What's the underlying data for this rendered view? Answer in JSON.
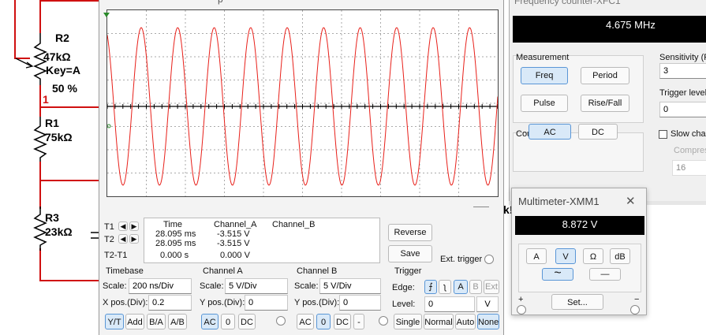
{
  "circuit": {
    "r2_name": "R2",
    "r2_value": "47kΩ",
    "r2_key": "Key=A",
    "r2_percent": "50 %",
    "node_number": "1",
    "r1_name": "R1",
    "r1_value": "75kΩ",
    "r3_name": "R3",
    "r3_value": "23kΩ",
    "clipped_label": "k!"
  },
  "oscilloscope": {
    "title_fragment": "p",
    "readout": {
      "headers": [
        "Time",
        "Channel_A",
        "Channel_B"
      ],
      "t1_label": "T1",
      "t2_label": "T2",
      "t2t1_label": "T2-T1",
      "t1": [
        "28.095 ms",
        "-3.515 V",
        ""
      ],
      "t2": [
        "28.095 ms",
        "-3.515 V",
        ""
      ],
      "t2t1": [
        "0.000 s",
        "0.000 V",
        ""
      ]
    },
    "reverse_label": "Reverse",
    "save_label": "Save",
    "ext_trigger_label": "Ext. trigger",
    "timebase": {
      "title": "Timebase",
      "scale_label": "Scale:",
      "scale_value": "200 ns/Div",
      "xpos_label": "X pos.(Div):",
      "xpos_value": "0.2",
      "buttons": [
        "Y/T",
        "Add",
        "B/A",
        "A/B"
      ]
    },
    "channel_a": {
      "title": "Channel A",
      "scale_label": "Scale:",
      "scale_value": "5  V/Div",
      "ypos_label": "Y pos.(Div):",
      "ypos_value": "0",
      "buttons": [
        "AC",
        "0",
        "DC"
      ]
    },
    "channel_b": {
      "title": "Channel B",
      "scale_label": "Scale:",
      "scale_value": "5  V/Div",
      "ypos_label": "Y pos.(Div):",
      "ypos_value": "0",
      "buttons": [
        "AC",
        "0",
        "DC",
        "-"
      ]
    },
    "trigger": {
      "title": "Trigger",
      "edge_label": "Edge:",
      "edge_buttons": [
        "⨍",
        "ʅ",
        "A",
        "B",
        "Ext"
      ],
      "level_label": "Level:",
      "level_value": "0",
      "level_unit": "V",
      "mode_buttons": [
        "Single",
        "Normal",
        "Auto",
        "None"
      ]
    },
    "trace_color": "#e8201a"
  },
  "frequency_counter": {
    "title": "Frequency counter-XFC1",
    "display_value": "4.675 MHz",
    "measurement_title": "Measurement",
    "measurement_buttons": [
      "Freq",
      "Period",
      "Pulse",
      "Rise/Fall"
    ],
    "coupling_title": "Coupling",
    "coupling_buttons": [
      "AC",
      "DC"
    ],
    "sensitivity_label": "Sensitivity (R",
    "sensitivity_value": "3",
    "trigger_level_label": "Trigger level",
    "trigger_level_value": "0",
    "slow_change_label": "Slow char",
    "compress_label": "Compres",
    "compress_value": "16"
  },
  "multimeter": {
    "title": "Multimeter-XMM1",
    "display_value": "8.872 V",
    "mode_buttons": [
      "A",
      "V",
      "Ω",
      "dB"
    ],
    "ac_symbol": "~",
    "dc_symbol": "—",
    "set_label": "Set...",
    "plus_label": "+",
    "minus_label": "−"
  }
}
